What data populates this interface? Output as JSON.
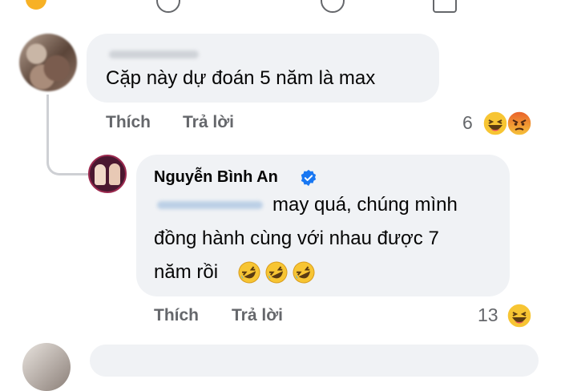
{
  "comments": [
    {
      "author": "",
      "text": "Cặp này dự đoán 5 năm là max",
      "actions": {
        "like": "Thích",
        "reply": "Trả lời"
      },
      "reaction_count": "6",
      "reactions": [
        "haha-icon",
        "angry-icon"
      ]
    },
    {
      "author": "Nguyễn Bình An",
      "verified": true,
      "text_line1": "may quá, chúng mình",
      "text_line2": "đồng hành cùng với nhau được 7",
      "text_line3": "năm rồi",
      "emojis": [
        "rofl-emoji",
        "rofl-emoji",
        "rofl-emoji"
      ],
      "actions": {
        "like": "Thích",
        "reply": "Trả lời"
      },
      "reaction_count": "13",
      "reactions": [
        "haha-icon"
      ]
    }
  ],
  "colors": {
    "bubble": "#f0f2f5",
    "meta_text": "#65676b",
    "verified": "#1877f2"
  }
}
